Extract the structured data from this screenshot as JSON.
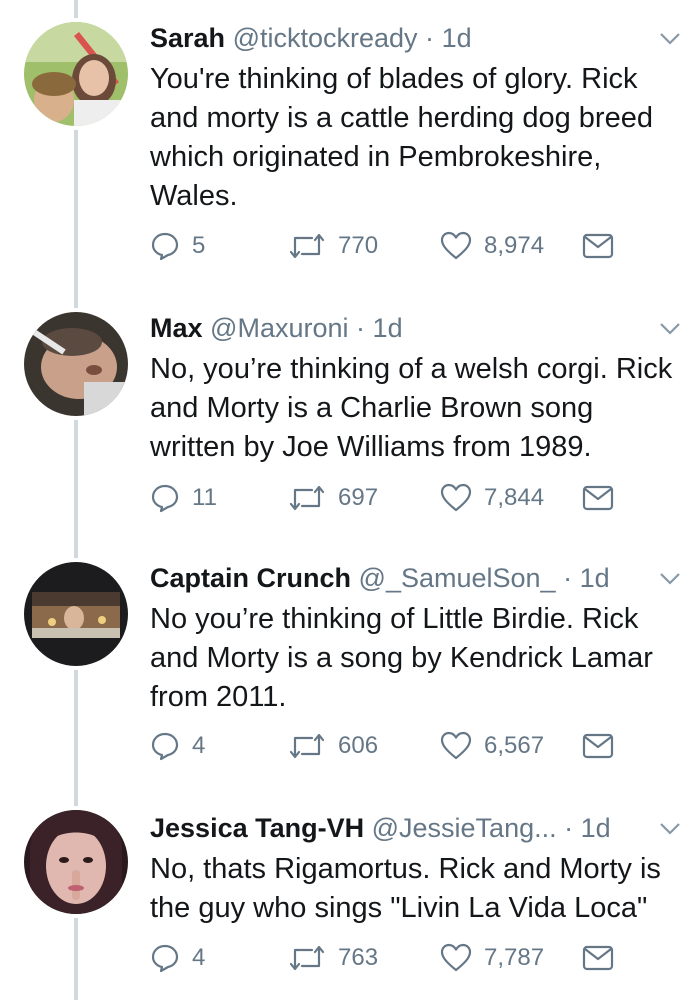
{
  "tweets": [
    {
      "name": "Sarah",
      "handle": "@ticktockready",
      "separator": "·",
      "time": "1d",
      "text": "You're thinking of blades of glory. Rick and morty is a cattle herding dog breed which originated in Pembrokeshire, Wales.",
      "replies": "5",
      "retweets": "770",
      "likes": "8,974"
    },
    {
      "name": "Max",
      "handle": "@Maxuroni",
      "separator": "·",
      "time": "1d",
      "text": "No, you’re thinking of a welsh corgi. Rick and Morty is a Charlie Brown song written by Joe Williams from 1989.",
      "replies": "11",
      "retweets": "697",
      "likes": "7,844"
    },
    {
      "name": "Captain Crunch",
      "handle": "@_SamuelSon_",
      "separator": "·",
      "time": "1d",
      "text": "No you’re thinking of Little Birdie. Rick and Morty is a song by Kendrick Lamar from 2011.",
      "replies": "4",
      "retweets": "606",
      "likes": "6,567"
    },
    {
      "name": "Jessica Tang-VH",
      "handle": "@JessieTang...",
      "separator": "·",
      "time": "1d",
      "text": "No, thats Rigamortus. Rick and Morty is the guy who sings \"Livin La Vida Loca\"",
      "replies": "4",
      "retweets": "763",
      "likes": "7,787"
    }
  ],
  "colors": {
    "text": "#14171a",
    "secondary": "#657786",
    "thread_line": "#cfd9de"
  },
  "icons": [
    "reply-icon",
    "retweet-icon",
    "like-icon",
    "direct-message-icon",
    "chevron-down-icon"
  ]
}
